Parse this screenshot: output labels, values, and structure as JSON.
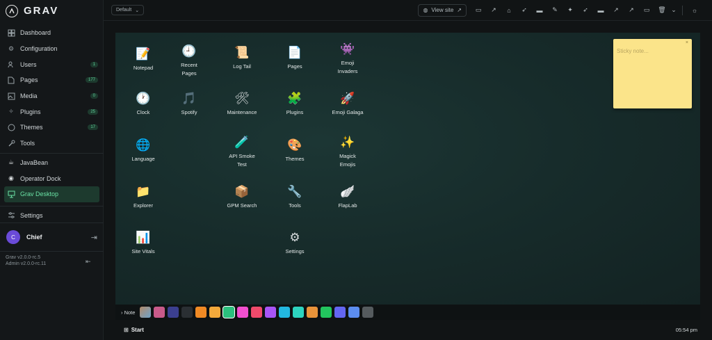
{
  "brand": {
    "name": "GRAV"
  },
  "sidebar": {
    "items": [
      {
        "label": "Dashboard",
        "icon": "gauge-icon",
        "badge": ""
      },
      {
        "label": "Configuration",
        "icon": "gear-icon",
        "badge": ""
      },
      {
        "label": "Users",
        "icon": "users-icon",
        "badge": "1"
      },
      {
        "label": "Pages",
        "icon": "file-icon",
        "badge": "177"
      },
      {
        "label": "Media",
        "icon": "image-icon",
        "badge": "0"
      },
      {
        "label": "Plugins",
        "icon": "puzzle-icon",
        "badge": "25"
      },
      {
        "label": "Themes",
        "icon": "palette-icon",
        "badge": "17"
      },
      {
        "label": "Tools",
        "icon": "wrench-icon",
        "badge": ""
      }
    ],
    "extra_items": [
      {
        "label": "JavaBean",
        "icon": "coffee-icon"
      },
      {
        "label": "Operator Dock",
        "icon": "dock-icon"
      },
      {
        "label": "Grav Desktop",
        "icon": "monitor-icon"
      }
    ],
    "settings_label": "Settings",
    "user": {
      "initial": "C",
      "name": "Chief"
    },
    "version_grav": "Grav v2.0.0-rc.5",
    "version_admin": "Admin v2.0.0-rc.11"
  },
  "topbar": {
    "environment": "Default",
    "view_site": "View site",
    "icons": [
      "monitor-icon",
      "external-link-icon",
      "graduation-cap-icon",
      "rocket-icon",
      "window-icon",
      "brush-icon",
      "magic-wand-icon",
      "rocket-icon",
      "window-icon",
      "external-link-icon",
      "external-link-icon",
      "monitor-icon",
      "trash-icon",
      "chevron-down-icon",
      "sun-icon"
    ]
  },
  "desktop": {
    "icons": [
      {
        "label": "Notepad",
        "glyph": "📝"
      },
      {
        "label": "Recent Pages",
        "glyph": "🕘"
      },
      {
        "label": "Log Tail",
        "glyph": "📜"
      },
      {
        "label": "Pages",
        "glyph": "📄"
      },
      {
        "label": "Emoji Invaders",
        "glyph": "👾"
      },
      {
        "label": "Clock",
        "glyph": "🕐"
      },
      {
        "label": "Spotify",
        "glyph": "🎵"
      },
      {
        "label": "Maintenance",
        "glyph": "🛠"
      },
      {
        "label": "Plugins",
        "glyph": "🧩"
      },
      {
        "label": "Emoji Galaga",
        "glyph": "🚀"
      },
      {
        "label": "Language",
        "glyph": "🌐"
      },
      {
        "label": "API Smoke Test",
        "glyph": "🧪"
      },
      {
        "label": "Themes",
        "glyph": "🎨"
      },
      {
        "label": "Magick Emojis",
        "glyph": "✨"
      },
      {
        "label": "Explorer",
        "glyph": "📁"
      },
      {
        "label": "GPM Search",
        "glyph": "📦"
      },
      {
        "label": "Tools",
        "glyph": "🔧"
      },
      {
        "label": "FlapLab",
        "glyph": "🪽"
      },
      {
        "label": "Site Vitals",
        "glyph": "📊"
      },
      {
        "label": "Settings",
        "glyph": "⚙"
      }
    ],
    "sticky": {
      "placeholder": "Sticky note...",
      "close": "×"
    }
  },
  "dock": {
    "note_label": "› Note",
    "swatches": [
      "#b08a6a",
      "#c85a8a",
      "#3b3f8f",
      "#2a2f33",
      "#f08a24",
      "#f2a93b",
      "#2bbf7d",
      "#f04fcf",
      "#ef4a6b",
      "#a855f7",
      "#22b8e0",
      "#2dd4bf",
      "#e8933a",
      "#22c55e",
      "#6366f1",
      "#5b8def",
      "#555b5e"
    ],
    "start_label": "Start",
    "clock": "05:54 pm"
  }
}
